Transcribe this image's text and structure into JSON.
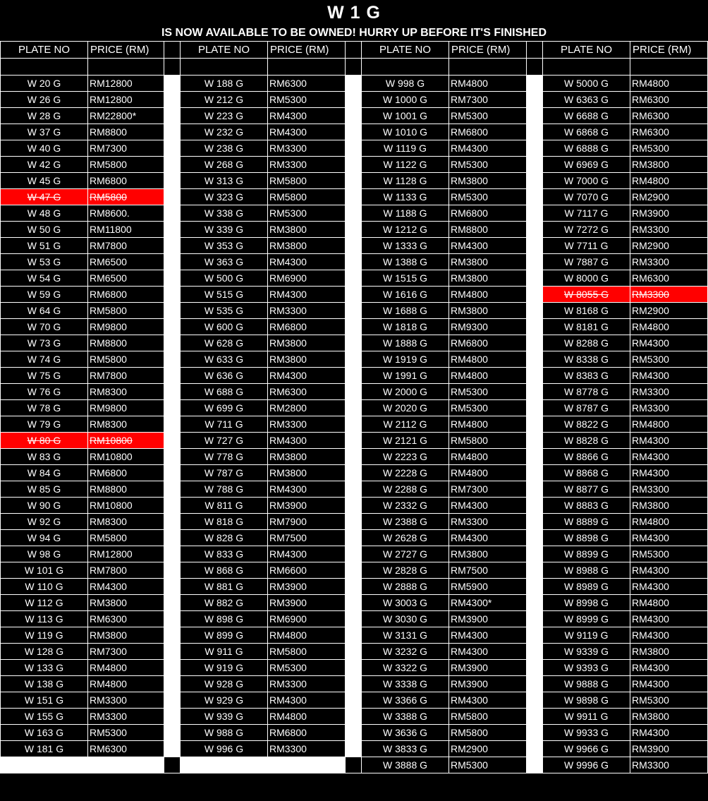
{
  "title": "W 1 G",
  "subtitle": "IS NOW AVAILABLE TO BE OWNED! HURRY UP BEFORE IT'S FINISHED",
  "headers": {
    "plate": "PLATE NO",
    "price": "PRICE (RM)"
  },
  "colors": {
    "background": "#000000",
    "text": "#ffffff",
    "sold_highlight": "#ff0000"
  },
  "columns": [
    {
      "rows": [
        {
          "plate": "W 20 G",
          "price": "RM12800"
        },
        {
          "plate": "W 26 G",
          "price": "RM12800"
        },
        {
          "plate": "W 28 G",
          "price": "RM22800*"
        },
        {
          "plate": "W 37 G",
          "price": "RM8800"
        },
        {
          "plate": "W 40 G",
          "price": "RM7300"
        },
        {
          "plate": "W 42 G",
          "price": "RM5800"
        },
        {
          "plate": "W 45 G",
          "price": "RM6800"
        },
        {
          "plate": "W 47 G",
          "price": "RM5800",
          "sold": true
        },
        {
          "plate": "W 48 G",
          "price": "RM8600."
        },
        {
          "plate": "W 50 G",
          "price": "RM11800"
        },
        {
          "plate": "W 51 G",
          "price": "RM7800"
        },
        {
          "plate": "W 53 G",
          "price": "RM6500"
        },
        {
          "plate": "W 54 G",
          "price": "RM6500"
        },
        {
          "plate": "W 59 G",
          "price": "RM6800"
        },
        {
          "plate": "W 64 G",
          "price": "RM5800"
        },
        {
          "plate": "W 70 G",
          "price": "RM9800"
        },
        {
          "plate": "W 73 G",
          "price": "RM8800"
        },
        {
          "plate": "W 74 G",
          "price": "RM5800"
        },
        {
          "plate": "W 75 G",
          "price": "RM7800"
        },
        {
          "plate": "W 76 G",
          "price": "RM8300"
        },
        {
          "plate": "W 78 G",
          "price": "RM9800"
        },
        {
          "plate": "W 79 G",
          "price": "RM8300"
        },
        {
          "plate": "W 80 G",
          "price": "RM10800",
          "sold": true
        },
        {
          "plate": "W 83 G",
          "price": "RM10800"
        },
        {
          "plate": "W 84 G",
          "price": "RM6800"
        },
        {
          "plate": "W 85 G",
          "price": "RM8800"
        },
        {
          "plate": "W 90 G",
          "price": "RM10800"
        },
        {
          "plate": "W 92 G",
          "price": "RM8300"
        },
        {
          "plate": "W 94 G",
          "price": "RM5800"
        },
        {
          "plate": "W 98 G",
          "price": "RM12800"
        },
        {
          "plate": "W 101 G",
          "price": "RM7800"
        },
        {
          "plate": "W 110 G",
          "price": "RM4300"
        },
        {
          "plate": "W 112 G",
          "price": "RM3800"
        },
        {
          "plate": "W 113 G",
          "price": "RM6300"
        },
        {
          "plate": "W 119 G",
          "price": "RM3800"
        },
        {
          "plate": "W 128 G",
          "price": "RM7300"
        },
        {
          "plate": "W 133 G",
          "price": "RM4800"
        },
        {
          "plate": "W 138 G",
          "price": "RM4800"
        },
        {
          "plate": "W 151 G",
          "price": "RM3300"
        },
        {
          "plate": "W 155 G",
          "price": "RM3300"
        },
        {
          "plate": "W 163 G",
          "price": "RM5300"
        },
        {
          "plate": "W 181 G",
          "price": "RM6300"
        }
      ]
    },
    {
      "rows": [
        {
          "plate": "W 188 G",
          "price": "RM6300"
        },
        {
          "plate": "W 212 G",
          "price": "RM5300"
        },
        {
          "plate": "W 223 G",
          "price": "RM4300"
        },
        {
          "plate": "W 232 G",
          "price": "RM4300"
        },
        {
          "plate": "W 238 G",
          "price": "RM3300"
        },
        {
          "plate": "W 268 G",
          "price": "RM3300"
        },
        {
          "plate": "W 313 G",
          "price": "RM5800"
        },
        {
          "plate": "W 323 G",
          "price": "RM5800"
        },
        {
          "plate": "W 338 G",
          "price": "RM5300"
        },
        {
          "plate": "W 339 G",
          "price": "RM3800"
        },
        {
          "plate": "W 353 G",
          "price": "RM3800"
        },
        {
          "plate": "W 363 G",
          "price": "RM4300"
        },
        {
          "plate": "W 500 G",
          "price": "RM6900"
        },
        {
          "plate": "W 515 G",
          "price": "RM4300"
        },
        {
          "plate": "W 535 G",
          "price": "RM3300"
        },
        {
          "plate": "W 600 G",
          "price": "RM6800"
        },
        {
          "plate": "W 628 G",
          "price": "RM3800"
        },
        {
          "plate": "W 633 G",
          "price": "RM3800"
        },
        {
          "plate": "W 636 G",
          "price": "RM4300"
        },
        {
          "plate": "W 688 G",
          "price": "RM6300"
        },
        {
          "plate": "W 699 G",
          "price": "RM2800"
        },
        {
          "plate": "W 711 G",
          "price": "RM3300"
        },
        {
          "plate": "W 727 G",
          "price": "RM4300"
        },
        {
          "plate": "W 778 G",
          "price": "RM3800"
        },
        {
          "plate": "W 787 G",
          "price": "RM3800"
        },
        {
          "plate": "W 788 G",
          "price": "RM4300"
        },
        {
          "plate": "W 811 G",
          "price": "RM3900"
        },
        {
          "plate": "W 818 G",
          "price": "RM7900"
        },
        {
          "plate": "W 828 G",
          "price": "RM7500"
        },
        {
          "plate": "W 833 G",
          "price": "RM4300"
        },
        {
          "plate": "W 868 G",
          "price": "RM6600"
        },
        {
          "plate": "W 881 G",
          "price": "RM3900"
        },
        {
          "plate": "W 882 G",
          "price": "RM3900"
        },
        {
          "plate": "W 898 G",
          "price": "RM6900"
        },
        {
          "plate": "W 899 G",
          "price": "RM4800"
        },
        {
          "plate": "W 911 G",
          "price": "RM5800"
        },
        {
          "plate": "W 919 G",
          "price": "RM5300"
        },
        {
          "plate": "W 928 G",
          "price": "RM3300"
        },
        {
          "plate": "W 929 G",
          "price": "RM4300"
        },
        {
          "plate": "W 939 G",
          "price": "RM4800"
        },
        {
          "plate": "W 988 G",
          "price": "RM6800"
        },
        {
          "plate": "W 996 G",
          "price": "RM3300"
        }
      ]
    },
    {
      "rows": [
        {
          "plate": "W 998 G",
          "price": "RM4800"
        },
        {
          "plate": "W 1000 G",
          "price": "RM7300"
        },
        {
          "plate": "W 1001 G",
          "price": "RM5300"
        },
        {
          "plate": "W 1010 G",
          "price": "RM6800"
        },
        {
          "plate": "W 1119 G",
          "price": "RM4300"
        },
        {
          "plate": "W 1122 G",
          "price": "RM5300"
        },
        {
          "plate": "W 1128 G",
          "price": "RM3800"
        },
        {
          "plate": "W 1133 G",
          "price": "RM5300"
        },
        {
          "plate": "W 1188 G",
          "price": "RM6800"
        },
        {
          "plate": "W 1212 G",
          "price": "RM8800"
        },
        {
          "plate": "W 1333 G",
          "price": "RM4300"
        },
        {
          "plate": "W 1388 G",
          "price": "RM3800"
        },
        {
          "plate": "W 1515 G",
          "price": "RM3800"
        },
        {
          "plate": "W 1616 G",
          "price": "RM4800"
        },
        {
          "plate": "W 1688 G",
          "price": "RM3800"
        },
        {
          "plate": "W 1818 G",
          "price": "RM9300"
        },
        {
          "plate": "W 1888 G",
          "price": "RM6800"
        },
        {
          "plate": "W 1919 G",
          "price": "RM4800"
        },
        {
          "plate": "W 1991 G",
          "price": "RM4800"
        },
        {
          "plate": "W 2000 G",
          "price": "RM5300"
        },
        {
          "plate": "W 2020 G",
          "price": "RM5300"
        },
        {
          "plate": "W 2112 G",
          "price": "RM4800"
        },
        {
          "plate": "W 2121 G",
          "price": "RM5800"
        },
        {
          "plate": "W 2223 G",
          "price": "RM4800"
        },
        {
          "plate": "W 2228 G",
          "price": "RM4800"
        },
        {
          "plate": "W 2288 G",
          "price": "RM7300"
        },
        {
          "plate": "W 2332 G",
          "price": "RM4300"
        },
        {
          "plate": "W 2388 G",
          "price": "RM3300"
        },
        {
          "plate": "W 2628 G",
          "price": "RM4300"
        },
        {
          "plate": "W 2727 G",
          "price": "RM3800"
        },
        {
          "plate": "W 2828 G",
          "price": "RM7500"
        },
        {
          "plate": "W 2888 G",
          "price": "RM5900"
        },
        {
          "plate": "W 3003 G",
          "price": "RM4300*"
        },
        {
          "plate": "W 3030 G",
          "price": "RM3900"
        },
        {
          "plate": "W 3131 G",
          "price": "RM4300"
        },
        {
          "plate": "W 3232 G",
          "price": "RM4300"
        },
        {
          "plate": "W 3322 G",
          "price": "RM3900"
        },
        {
          "plate": "W 3338 G",
          "price": "RM3900"
        },
        {
          "plate": "W 3366 G",
          "price": "RM4300"
        },
        {
          "plate": "W 3388 G",
          "price": "RM5800"
        },
        {
          "plate": "W 3636 G",
          "price": "RM5800"
        },
        {
          "plate": "W 3833 G",
          "price": "RM2900"
        },
        {
          "plate": "W 3888 G",
          "price": "RM5300"
        }
      ]
    },
    {
      "rows": [
        {
          "plate": "W 5000 G",
          "price": "RM4800"
        },
        {
          "plate": "W 6363 G",
          "price": "RM6300"
        },
        {
          "plate": "W 6688 G",
          "price": "RM6300"
        },
        {
          "plate": "W 6868 G",
          "price": "RM6300"
        },
        {
          "plate": "W 6888 G",
          "price": "RM5300"
        },
        {
          "plate": "W 6969 G",
          "price": "RM3800"
        },
        {
          "plate": "W 7000 G",
          "price": "RM4800"
        },
        {
          "plate": "W 7070 G",
          "price": "RM2900"
        },
        {
          "plate": "W 7117 G",
          "price": "RM3900"
        },
        {
          "plate": "W 7272 G",
          "price": "RM3300"
        },
        {
          "plate": "W 7711 G",
          "price": "RM2900"
        },
        {
          "plate": "W 7887 G",
          "price": "RM3300"
        },
        {
          "plate": "W 8000 G",
          "price": "RM6300"
        },
        {
          "plate": "W 8055 G",
          "price": "RM3300",
          "sold": true
        },
        {
          "plate": "W 8168  G",
          "price": "RM2900"
        },
        {
          "plate": "W 8181 G",
          "price": "RM4800"
        },
        {
          "plate": "W 8288 G",
          "price": "RM4300"
        },
        {
          "plate": "W 8338 G",
          "price": "RM5300"
        },
        {
          "plate": "W 8383 G",
          "price": "RM4300"
        },
        {
          "plate": "W 8778 G",
          "price": "RM3300"
        },
        {
          "plate": "W 8787 G",
          "price": "RM3300"
        },
        {
          "plate": "W 8822 G",
          "price": "RM4800"
        },
        {
          "plate": "W 8828 G",
          "price": "RM4300"
        },
        {
          "plate": "W 8866 G",
          "price": "RM4300"
        },
        {
          "plate": "W 8868 G",
          "price": "RM4300"
        },
        {
          "plate": "W 8877 G",
          "price": "RM3300"
        },
        {
          "plate": "W 8883 G",
          "price": "RM3800"
        },
        {
          "plate": "W 8889 G",
          "price": "RM4800"
        },
        {
          "plate": "W 8898 G",
          "price": "RM4300"
        },
        {
          "plate": "W 8899 G",
          "price": "RM5300"
        },
        {
          "plate": "W 8988 G",
          "price": "RM4300"
        },
        {
          "plate": "W 8989 G",
          "price": "RM4300"
        },
        {
          "plate": "W 8998 G",
          "price": "RM4800"
        },
        {
          "plate": "W 8999 G",
          "price": "RM4300"
        },
        {
          "plate": "W 9119 G",
          "price": "RM4300"
        },
        {
          "plate": "W 9339 G",
          "price": "RM3800"
        },
        {
          "plate": "W 9393 G",
          "price": "RM4300"
        },
        {
          "plate": "W 9888 G",
          "price": "RM4300"
        },
        {
          "plate": "W 9898 G",
          "price": "RM5300"
        },
        {
          "plate": "W 9911 G",
          "price": "RM3800"
        },
        {
          "plate": "W 9933 G",
          "price": "RM4300"
        },
        {
          "plate": "W 9966 G",
          "price": "RM3900"
        },
        {
          "plate": "W 9996 G",
          "price": "RM3300"
        }
      ]
    }
  ]
}
